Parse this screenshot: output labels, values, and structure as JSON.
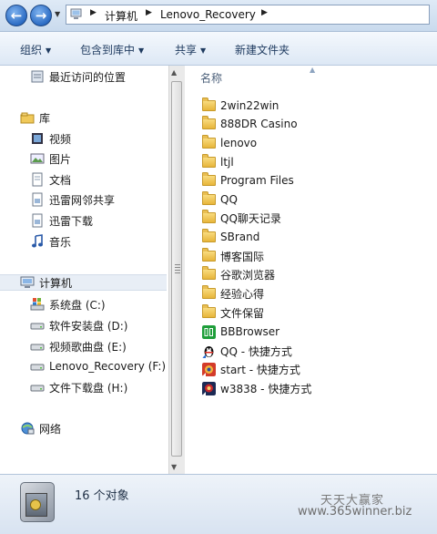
{
  "address": {
    "crumbs": [
      "计算机",
      "Lenovo_Recovery"
    ]
  },
  "toolbar": {
    "organize": "组织",
    "include_library": "包含到库中",
    "share": "共享",
    "new_folder": "新建文件夹"
  },
  "nav": {
    "recent": "最近访问的位置",
    "library": "库",
    "libs": [
      "视频",
      "图片",
      "文档",
      "迅雷网邻共享",
      "迅雷下载",
      "音乐"
    ],
    "computer": "计算机",
    "drives": [
      "系统盘 (C:)",
      "软件安装盘 (D:)",
      "视频歌曲盘 (E:)",
      "Lenovo_Recovery (F:)",
      "文件下载盘 (H:)"
    ],
    "network": "网络"
  },
  "content": {
    "column_name": "名称",
    "items": [
      {
        "name": "2win22win",
        "icon": "folder-icon"
      },
      {
        "name": "888DR Casino",
        "icon": "folder-icon"
      },
      {
        "name": "lenovo",
        "icon": "folder-icon"
      },
      {
        "name": "ltjl",
        "icon": "folder-icon"
      },
      {
        "name": "Program Files",
        "icon": "folder-icon"
      },
      {
        "name": "QQ",
        "icon": "folder-icon"
      },
      {
        "name": "QQ聊天记录",
        "icon": "folder-icon"
      },
      {
        "name": "SBrand",
        "icon": "folder-icon"
      },
      {
        "name": "博客国际",
        "icon": "folder-icon"
      },
      {
        "name": "谷歌浏览器",
        "icon": "folder-icon"
      },
      {
        "name": "经验心得",
        "icon": "folder-icon"
      },
      {
        "name": "文件保留",
        "icon": "folder-icon"
      },
      {
        "name": "BBBrowser",
        "icon": "bbbrowser-icon"
      },
      {
        "name": "QQ - 快捷方式",
        "icon": "qq-penguin-icon"
      },
      {
        "name": "start - 快捷方式",
        "icon": "start-app-icon"
      },
      {
        "name": "w3838 - 快捷方式",
        "icon": "w3838-app-icon"
      }
    ]
  },
  "status": {
    "count_text": "16 个对象"
  },
  "watermark": {
    "line1": "天天大赢家",
    "line2": "www.365winner.biz"
  }
}
